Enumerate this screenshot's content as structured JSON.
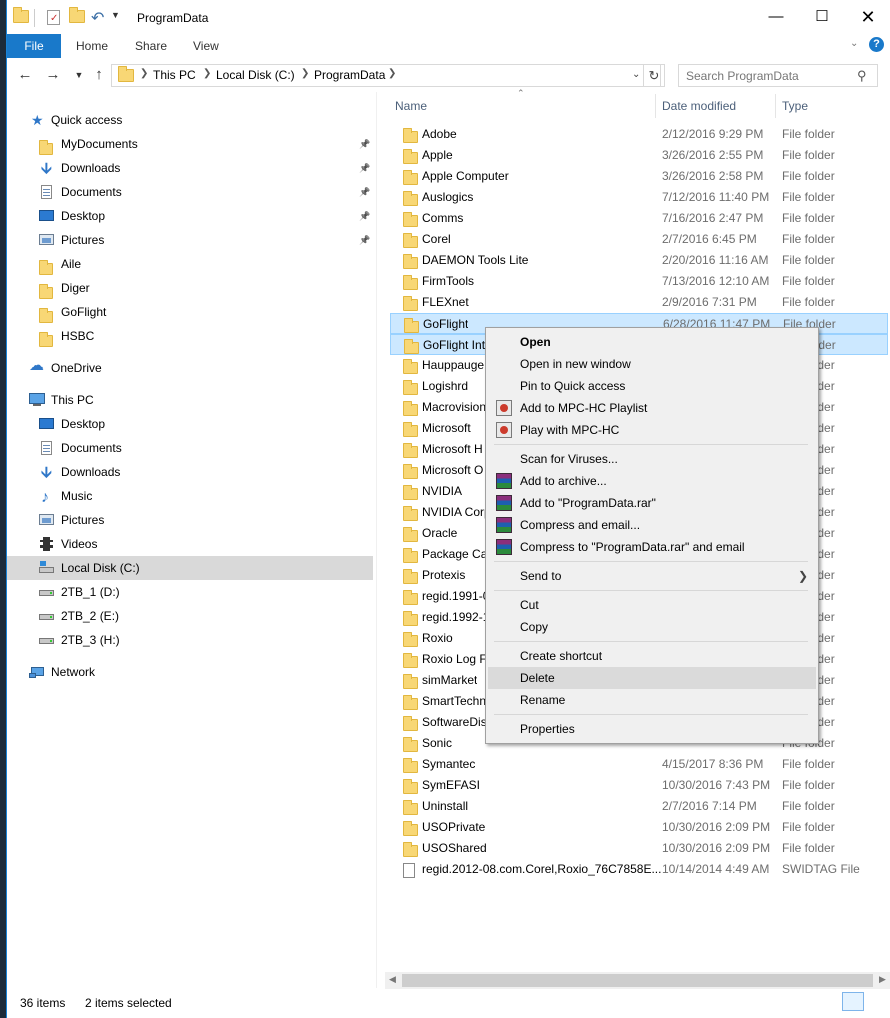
{
  "window": {
    "title": "ProgramData"
  },
  "ribbon": {
    "tabs": [
      "File",
      "Home",
      "Share",
      "View"
    ]
  },
  "address": {
    "crumbs": [
      "This PC",
      "Local Disk (C:)",
      "ProgramData"
    ],
    "search_placeholder": "Search ProgramData"
  },
  "nav": {
    "quick_access": "Quick access",
    "quick_items": [
      {
        "label": "MyDocuments",
        "icon": "folder-icon",
        "pinned": true
      },
      {
        "label": "Downloads",
        "icon": "downloads-icon",
        "pinned": true
      },
      {
        "label": "Documents",
        "icon": "documents-icon",
        "pinned": true
      },
      {
        "label": "Desktop",
        "icon": "desktop-icon",
        "pinned": true
      },
      {
        "label": "Pictures",
        "icon": "pictures-icon",
        "pinned": true
      },
      {
        "label": "Aile",
        "icon": "folder-icon",
        "pinned": false
      },
      {
        "label": "Diger",
        "icon": "folder-icon",
        "pinned": false
      },
      {
        "label": "GoFlight",
        "icon": "folder-icon",
        "pinned": false
      },
      {
        "label": "HSBC",
        "icon": "folder-icon",
        "pinned": false
      }
    ],
    "onedrive": "OneDrive",
    "this_pc": "This PC",
    "pc_items": [
      {
        "label": "Desktop",
        "icon": "desktop-icon"
      },
      {
        "label": "Documents",
        "icon": "documents-icon"
      },
      {
        "label": "Downloads",
        "icon": "downloads-icon"
      },
      {
        "label": "Music",
        "icon": "music-icon"
      },
      {
        "label": "Pictures",
        "icon": "pictures-icon"
      },
      {
        "label": "Videos",
        "icon": "videos-icon"
      },
      {
        "label": "Local Disk (C:)",
        "icon": "system-drive-icon",
        "selected": true
      },
      {
        "label": "2TB_1 (D:)",
        "icon": "drive-icon"
      },
      {
        "label": "2TB_2 (E:)",
        "icon": "drive-icon"
      },
      {
        "label": "2TB_3 (H:)",
        "icon": "drive-icon"
      }
    ],
    "network": "Network"
  },
  "columns": {
    "name": "Name",
    "date": "Date modified",
    "type": "Type"
  },
  "files": [
    {
      "name": "Adobe",
      "date": "2/12/2016 9:29 PM",
      "type": "File folder"
    },
    {
      "name": "Apple",
      "date": "3/26/2016 2:55 PM",
      "type": "File folder"
    },
    {
      "name": "Apple Computer",
      "date": "3/26/2016 2:58 PM",
      "type": "File folder"
    },
    {
      "name": "Auslogics",
      "date": "7/12/2016 11:40 PM",
      "type": "File folder"
    },
    {
      "name": "Comms",
      "date": "7/16/2016 2:47 PM",
      "type": "File folder"
    },
    {
      "name": "Corel",
      "date": "2/7/2016 6:45 PM",
      "type": "File folder"
    },
    {
      "name": "DAEMON Tools Lite",
      "date": "2/20/2016 11:16 AM",
      "type": "File folder"
    },
    {
      "name": "FirmTools",
      "date": "7/13/2016 12:10 AM",
      "type": "File folder"
    },
    {
      "name": "FLEXnet",
      "date": "2/9/2016 7:31 PM",
      "type": "File folder"
    },
    {
      "name": "GoFlight",
      "date": "6/28/2016 11:47 PM",
      "type": "File folder",
      "selected": true
    },
    {
      "name": "GoFlight Int",
      "date": "",
      "type": "File folder",
      "selected": true
    },
    {
      "name": "Hauppauge",
      "date": "",
      "type": "File folder"
    },
    {
      "name": "Logishrd",
      "date": "",
      "type": "File folder"
    },
    {
      "name": "Macrovision",
      "date": "",
      "type": "File folder"
    },
    {
      "name": "Microsoft",
      "date": "",
      "type": "File folder"
    },
    {
      "name": "Microsoft H",
      "date": "",
      "type": "File folder"
    },
    {
      "name": "Microsoft O",
      "date": "",
      "type": "File folder"
    },
    {
      "name": "NVIDIA",
      "date": "",
      "type": "File folder"
    },
    {
      "name": "NVIDIA Corp",
      "date": "",
      "type": "File folder"
    },
    {
      "name": "Oracle",
      "date": "",
      "type": "File folder"
    },
    {
      "name": "Package Cac",
      "date": "",
      "type": "File folder"
    },
    {
      "name": "Protexis",
      "date": "",
      "type": "File folder"
    },
    {
      "name": "regid.1991-0",
      "date": "",
      "type": "File folder"
    },
    {
      "name": "regid.1992-1",
      "date": "",
      "type": "File folder"
    },
    {
      "name": "Roxio",
      "date": "",
      "type": "File folder"
    },
    {
      "name": "Roxio Log Fi",
      "date": "",
      "type": "File folder"
    },
    {
      "name": "simMarket",
      "date": "",
      "type": "File folder"
    },
    {
      "name": "SmartTechn",
      "date": "",
      "type": "File folder"
    },
    {
      "name": "SoftwareDist",
      "date": "",
      "type": "File folder"
    },
    {
      "name": "Sonic",
      "date": "",
      "type": "File folder"
    },
    {
      "name": "Symantec",
      "date": "4/15/2017 8:36 PM",
      "type": "File folder"
    },
    {
      "name": "SymEFASI",
      "date": "10/30/2016 7:43 PM",
      "type": "File folder"
    },
    {
      "name": "Uninstall",
      "date": "2/7/2016 7:14 PM",
      "type": "File folder"
    },
    {
      "name": "USOPrivate",
      "date": "10/30/2016 2:09 PM",
      "type": "File folder"
    },
    {
      "name": "USOShared",
      "date": "10/30/2016 2:09 PM",
      "type": "File folder"
    },
    {
      "name": "regid.2012-08.com.Corel,Roxio_76C7858E...",
      "date": "10/14/2014 4:49 AM",
      "type": "SWIDTAG File",
      "file": true
    }
  ],
  "context_menu": [
    {
      "label": "Open",
      "bold": true
    },
    {
      "label": "Open in new window"
    },
    {
      "label": "Pin to Quick access"
    },
    {
      "label": "Add to MPC-HC Playlist",
      "icon": "mpc-hc-icon"
    },
    {
      "label": "Play with MPC-HC",
      "icon": "mpc-hc-icon"
    },
    {
      "sep": true
    },
    {
      "label": "Scan for Viruses..."
    },
    {
      "label": "Add to archive...",
      "icon": "winrar-icon"
    },
    {
      "label": "Add to \"ProgramData.rar\"",
      "icon": "winrar-icon"
    },
    {
      "label": "Compress and email...",
      "icon": "winrar-icon"
    },
    {
      "label": "Compress to \"ProgramData.rar\" and email",
      "icon": "winrar-icon"
    },
    {
      "sep": true
    },
    {
      "label": "Send to",
      "submenu": true
    },
    {
      "sep": true
    },
    {
      "label": "Cut"
    },
    {
      "label": "Copy"
    },
    {
      "sep": true
    },
    {
      "label": "Create shortcut"
    },
    {
      "label": "Delete",
      "highlighted": true
    },
    {
      "label": "Rename"
    },
    {
      "sep": true
    },
    {
      "label": "Properties"
    }
  ],
  "status": {
    "items": "36 items",
    "selected": "2 items selected"
  },
  "colors": {
    "accent": "#1979ca",
    "selection": "#cce8ff",
    "folder": "#f8d775"
  }
}
